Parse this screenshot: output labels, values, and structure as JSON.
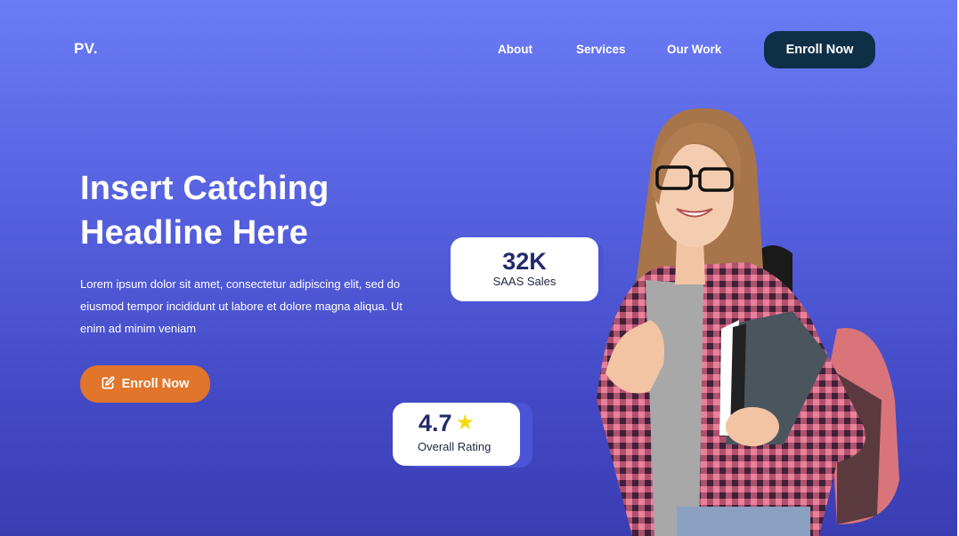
{
  "nav": {
    "logo": "PV.",
    "links": [
      "About",
      "Services",
      "Our Work"
    ],
    "enroll_label": "Enroll Now"
  },
  "hero": {
    "headline_line1": "Insert Catching",
    "headline_line2": "Headline Here",
    "description": "Lorem ipsum dolor sit amet, consectetur adipiscing elit, sed do eiusmod tempor incididunt ut labore et dolore magna aliqua. Ut enim ad minim veniam",
    "cta_label": "Enroll Now",
    "cta_icon": "edit-icon"
  },
  "stats": {
    "sales_value": "32K",
    "sales_label": "SAAS Sales",
    "rating_value": "4.7",
    "rating_label": "Overall Rating",
    "rating_icon": "star-icon"
  },
  "colors": {
    "background_top": "#6b7bf5",
    "background_bottom": "#3a3db2",
    "nav_button": "#0f2f47",
    "cta_button": "#e0752b",
    "star": "#f5d90a",
    "stat_value": "#232a6b"
  }
}
